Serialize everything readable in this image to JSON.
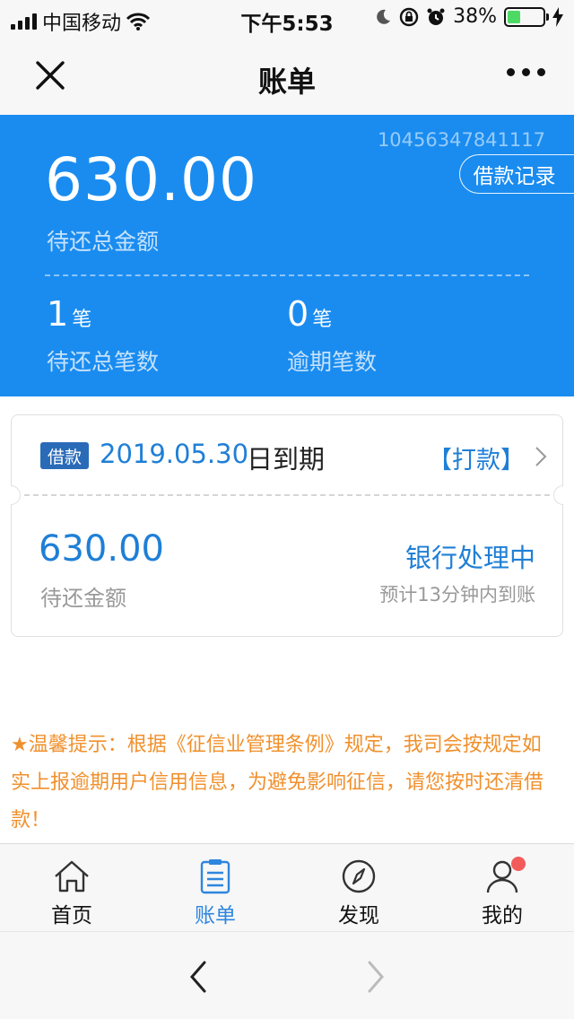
{
  "status_bar": {
    "carrier": "中国移动",
    "time": "下午5:53",
    "battery_percent_text": "38%",
    "battery_level": 0.38
  },
  "nav": {
    "title": "账单"
  },
  "summary": {
    "order_no": "10456347841117",
    "loan_records_label": "借款记录",
    "total_amount": "630.00",
    "total_amount_label": "待还总金额",
    "pending_count": "1",
    "pending_unit": "笔",
    "pending_label": "待还总笔数",
    "overdue_count": "0",
    "overdue_unit": "笔",
    "overdue_label": "逾期笔数"
  },
  "bill_card": {
    "tag": "借款",
    "due_date": "2019.05.30",
    "due_suffix": "日到期",
    "action": "【打款】",
    "amount": "630.00",
    "amount_label": "待还金额",
    "status": "银行处理中",
    "eta": "预计13分钟内到账"
  },
  "tip": {
    "text": "★温馨提示：根据《征信业管理条例》规定，我司会按规定如实上报逾期用户信用信息，为避免影响征信，请您按时还清借款！"
  },
  "tabs": [
    {
      "label": "首页",
      "icon": "home-icon"
    },
    {
      "label": "账单",
      "icon": "bill-icon",
      "active": true
    },
    {
      "label": "发现",
      "icon": "compass-icon"
    },
    {
      "label": "我的",
      "icon": "user-icon",
      "badge": true
    }
  ],
  "colors": {
    "primary_blue": "#1a8cf0",
    "link_blue": "#1f7fd6",
    "tip_orange": "#f0902c",
    "badge_red": "#f35b5b"
  }
}
